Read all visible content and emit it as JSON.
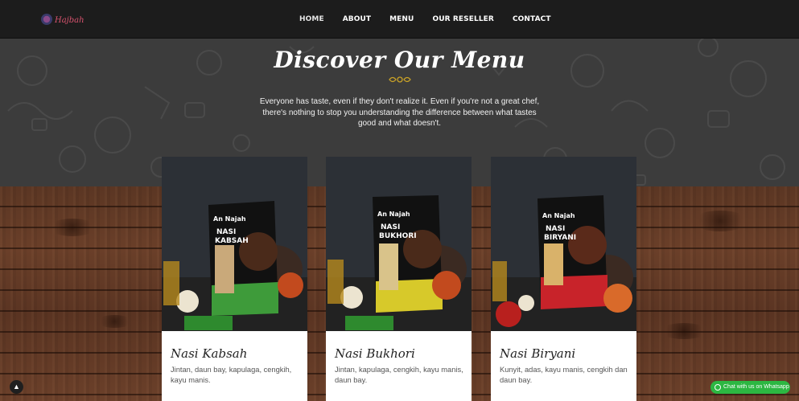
{
  "nav": {
    "items": [
      {
        "label": "HOME"
      },
      {
        "label": "ABOUT"
      },
      {
        "label": "MENU"
      },
      {
        "label": "OUR RESELLER"
      },
      {
        "label": "CONTACT"
      }
    ]
  },
  "hero": {
    "title": "Discover Our Menu",
    "text": "Everyone has taste, even if they don't realize it. Even if you're not a great chef, there's nothing to stop you understanding the difference between what tastes good and what doesn't."
  },
  "cards": [
    {
      "name": "Nasi Kabsah",
      "desc": "Jintan, daun bay, kapulaga, cengkih, kayu manis.",
      "pouch_line1": "NASI",
      "pouch_line2": "KABSAH",
      "pouch_color": "#3e9b3a"
    },
    {
      "name": "Nasi Bukhori",
      "desc": "Jintan, kapulaga, cengkih, kayu manis, daun bay.",
      "pouch_line1": "NASI",
      "pouch_line2": "BUKHORI",
      "pouch_color": "#d7c92a"
    },
    {
      "name": "Nasi Biryani",
      "desc": "Kunyit, adas, kayu manis, cengkih dan daun bay.",
      "pouch_line1": "NASI",
      "pouch_line2": "BIRYANI",
      "pouch_color": "#c8232a"
    }
  ],
  "whatsapp": {
    "label": "Chat with us on Whatsapp"
  },
  "colors": {
    "navbar": "#1c1c1c",
    "hero": "#3c3c3c",
    "whatsapp": "#2cb742",
    "ornament": "#c9a227"
  }
}
